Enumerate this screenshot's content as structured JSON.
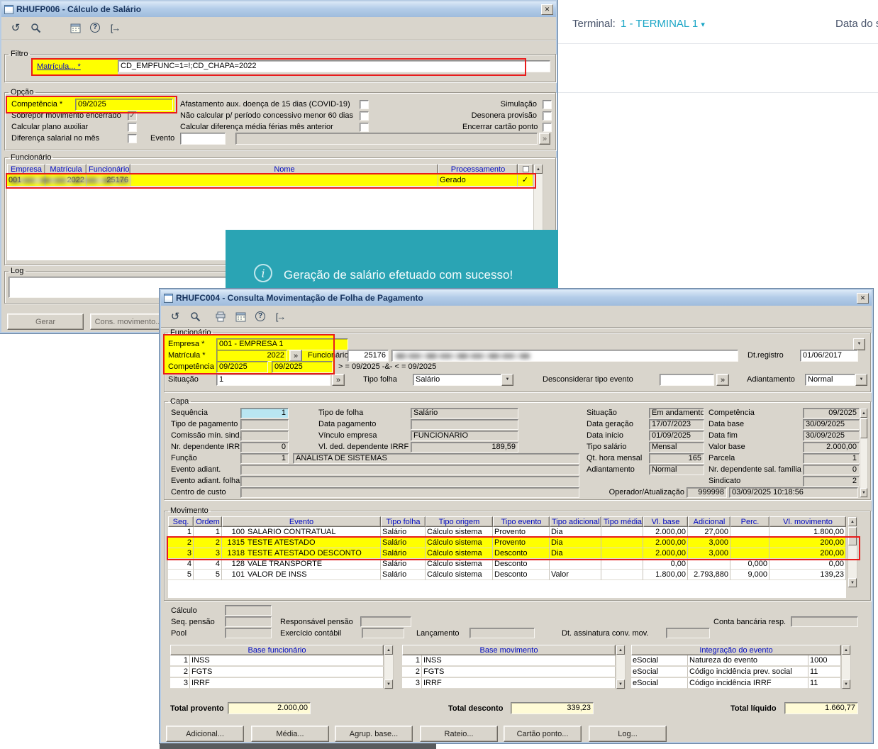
{
  "glyphs": {
    "close": "✕",
    "caret": "▾",
    "lookup": "»",
    "check": "✓",
    "up": "▲",
    "down": "▼",
    "help": "?",
    "refresh": "↺",
    "exit": "[→",
    "info": "i"
  },
  "right_panel": {
    "terminal_label": "Terminal:",
    "terminal_value": "1 - TERMINAL 1",
    "date_label": "Data do si"
  },
  "toast": {
    "message": "Geração de salário efetuado com sucesso!"
  },
  "window1": {
    "title": "RHUFP006 - Cálculo de Salário",
    "filtro": {
      "legend": "Filtro",
      "matricula_link": "Matrícula... *",
      "expression": "CD_EMPFUNC=1=!;CD_CHAPA=2022"
    },
    "opcao": {
      "legend": "Opção",
      "competencia_label": "Competência *",
      "competencia_value": "09/2025",
      "sobrepor": "Sobrepor movimento encerrado",
      "plano_aux": "Calcular plano auxiliar",
      "dif_salarial": "Diferença salarial no mês",
      "evento_label": "Evento",
      "afastamento": "Afastamento aux. doença de 15 dias (COVID-19)",
      "nao_calcular": "Não calcular p/ período concessivo menor 60 dias",
      "dif_media": "Calcular diferença média férias mês anterior",
      "simulacao": "Simulação",
      "desonera": "Desonera provisão",
      "encerrar": "Encerrar cartão ponto"
    },
    "grid": {
      "legend": "Funcionário",
      "headers": [
        "Empresa",
        "Matrícula",
        "Funcionário",
        "Nome",
        "Processamento"
      ],
      "row": {
        "empresa": "001",
        "matricula": "2022",
        "funcionario": "25176",
        "processamento": "Gerado"
      }
    },
    "log_legend": "Log",
    "gerar": "Gerar",
    "cons_movimento": "Cons. movimento..."
  },
  "window2": {
    "title": "RHUFC004 - Consulta Movimentação de Folha de Pagamento",
    "func": {
      "legend": "Funcionário",
      "empresa_label": "Empresa *",
      "empresa_value": "001 - EMPRESA 1",
      "matricula_label": "Matrícula *",
      "matricula_value": "2022",
      "funcionario_label": "Funcionário",
      "funcionario_code": "25176",
      "dt_registro_label": "Dt.registro",
      "dt_registro_value": "01/06/2017",
      "competencia_label": "Competência *",
      "competencia_de": "09/2025",
      "competencia_ate": "09/2025",
      "competencia_hint": "> = 09/2025 -&- < = 09/2025",
      "situacao_label": "Situação",
      "situacao_value": "1",
      "tipo_folha_label": "Tipo folha",
      "tipo_folha_value": "Salário",
      "desconsiderar_label": "Desconsiderar tipo evento",
      "adiantamento_label": "Adiantamento",
      "adiantamento_value": "Normal"
    },
    "capa": {
      "legend": "Capa",
      "sequencia_label": "Sequência",
      "sequencia_value": "1",
      "tipo_pagamento_label": "Tipo de pagamento",
      "comissao_label": "Comissão mín. sind.",
      "nr_dep_irrf_label": "Nr. dependente IRRF",
      "nr_dep_irrf_value": "0",
      "funcao_label": "Função",
      "funcao_value": "1",
      "funcao_nome": "ANALISTA DE SISTEMAS",
      "evento_adiant_label": "Evento adiant.",
      "evento_adiant_folha_label": "Evento adiant. folha",
      "centro_custo_label": "Centro de custo",
      "tipo_folha_label": "Tipo de folha",
      "tipo_folha_value": "Salário",
      "data_pagamento_label": "Data pagamento",
      "vinculo_label": "Vínculo empresa",
      "vinculo_value": "FUNCIONARIO",
      "vl_ded_label": "Vl. ded. dependente IRRF",
      "vl_ded_value": "189,59",
      "situacao_label": "Situação",
      "situacao_value": "Em andamento",
      "data_geracao_label": "Data geração",
      "data_geracao_value": "17/07/2023",
      "data_inicio_label": "Data início",
      "data_inicio_value": "01/09/2025",
      "tipo_salario_label": "Tipo salário",
      "tipo_salario_value": "Mensal",
      "qt_hora_label": "Qt. hora mensal",
      "qt_hora_value": "165",
      "adiantamento_label": "Adiantamento",
      "adiantamento_value": "Normal",
      "competencia_label": "Competência",
      "competencia_value": "09/2025",
      "data_base_label": "Data base",
      "data_base_value": "30/09/2025",
      "data_fim_label": "Data fim",
      "data_fim_value": "30/09/2025",
      "valor_base_label": "Valor base",
      "valor_base_value": "2.000,00",
      "parcela_label": "Parcela",
      "parcela_value": "1",
      "nr_dep_sal_label": "Nr. dependente sal. família",
      "nr_dep_sal_value": "0",
      "sindicato_label": "Sindicato",
      "sindicato_value": "2",
      "operador_label": "Operador/Atualização",
      "operador_value": "999998",
      "atualizacao_value": "03/09/2025 10:18:56"
    },
    "movimento": {
      "legend": "Movimento",
      "headers": [
        "Seq.",
        "Ordem",
        "Evento",
        "Tipo folha",
        "Tipo origem",
        "Tipo evento",
        "Tipo adicional",
        "Tipo média",
        "Vl. base",
        "Adicional",
        "Perc.",
        "Vl. movimento"
      ],
      "rows": [
        {
          "seq": "1",
          "ordem": "1",
          "codigo": "100",
          "evento": "SALARIO CONTRATUAL",
          "tipo_folha": "Salário",
          "tipo_origem": "Cálculo sistema",
          "tipo_evento": "Provento",
          "tipo_adicional": "Dia",
          "tipo_media": "",
          "vl_base": "2.000,00",
          "adicional": "27,000",
          "perc": "",
          "vl_movimento": "1.800,00"
        },
        {
          "seq": "2",
          "ordem": "2",
          "codigo": "1315",
          "evento": "TESTE ATESTADO",
          "tipo_folha": "Salário",
          "tipo_origem": "Cálculo sistema",
          "tipo_evento": "Provento",
          "tipo_adicional": "Dia",
          "tipo_media": "",
          "vl_base": "2.000,00",
          "adicional": "3,000",
          "perc": "",
          "vl_movimento": "200,00"
        },
        {
          "seq": "3",
          "ordem": "3",
          "codigo": "1318",
          "evento": "TESTE ATESTADO DESCONTO",
          "tipo_folha": "Salário",
          "tipo_origem": "Cálculo sistema",
          "tipo_evento": "Desconto",
          "tipo_adicional": "Dia",
          "tipo_media": "",
          "vl_base": "2.000,00",
          "adicional": "3,000",
          "perc": "",
          "vl_movimento": "200,00"
        },
        {
          "seq": "4",
          "ordem": "4",
          "codigo": "128",
          "evento": "VALE TRANSPORTE",
          "tipo_folha": "Salário",
          "tipo_origem": "Cálculo sistema",
          "tipo_evento": "Desconto",
          "tipo_adicional": "",
          "tipo_media": "",
          "vl_base": "0,00",
          "adicional": "",
          "perc": "0,000",
          "vl_movimento": "0,00"
        },
        {
          "seq": "5",
          "ordem": "5",
          "codigo": "101",
          "evento": "VALOR DE INSS",
          "tipo_folha": "Salário",
          "tipo_origem": "Cálculo sistema",
          "tipo_evento": "Desconto",
          "tipo_adicional": "Valor",
          "tipo_media": "",
          "vl_base": "1.800,00",
          "adicional": "2.793,880",
          "perc": "9,000",
          "vl_movimento": "139,23"
        }
      ]
    },
    "detalhes": {
      "calculo_label": "Cálculo",
      "seq_pensao_label": "Seq. pensão",
      "pool_label": "Pool",
      "responsavel_label": "Responsável pensão",
      "exercicio_label": "Exercício contábil",
      "lancamento_label": "Lançamento",
      "dt_assinatura_label": "Dt. assinatura conv. mov.",
      "conta_bancaria_label": "Conta bancária resp."
    },
    "bases": {
      "funcionario": {
        "title": "Base funcionário",
        "rows": [
          {
            "num": "1",
            "name": "INSS"
          },
          {
            "num": "2",
            "name": "FGTS"
          },
          {
            "num": "3",
            "name": "IRRF"
          }
        ]
      },
      "movimento": {
        "title": "Base movimento",
        "rows": [
          {
            "num": "1",
            "name": "INSS"
          },
          {
            "num": "2",
            "name": "FGTS"
          },
          {
            "num": "3",
            "name": "IRRF"
          }
        ]
      },
      "integracao": {
        "title": "Integração do evento",
        "rows": [
          {
            "tipo": "eSocial",
            "desc": "Natureza do evento",
            "valor": "1000"
          },
          {
            "tipo": "eSocial",
            "desc": "Código incidência prev. social",
            "valor": "11"
          },
          {
            "tipo": "eSocial",
            "desc": "Código incidência IRRF",
            "valor": "11"
          }
        ]
      }
    },
    "totais": {
      "provento_label": "Total provento",
      "provento_value": "2.000,00",
      "desconto_label": "Total desconto",
      "desconto_value": "339,23",
      "liquido_label": "Total líquido",
      "liquido_value": "1.660,77"
    },
    "buttons": [
      "Adicional...",
      "Média...",
      "Agrup. base...",
      "Rateio...",
      "Cartão ponto...",
      "Log..."
    ]
  }
}
